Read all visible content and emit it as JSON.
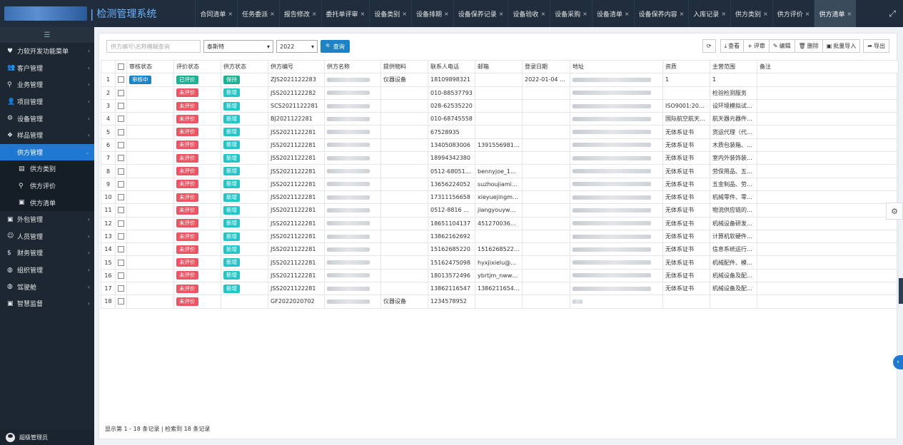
{
  "app": {
    "title": "检测管理系统",
    "separator": "|"
  },
  "tabs": [
    {
      "label": "合同清单"
    },
    {
      "label": "任务委派"
    },
    {
      "label": "报告修改"
    },
    {
      "label": "委托单评审"
    },
    {
      "label": "设备类别"
    },
    {
      "label": "设备排期"
    },
    {
      "label": "设备保养记录"
    },
    {
      "label": "设备验收"
    },
    {
      "label": "设备采购"
    },
    {
      "label": "设备清单"
    },
    {
      "label": "设备保养内容"
    },
    {
      "label": "入库记录"
    },
    {
      "label": "供方类别"
    },
    {
      "label": "供方评价"
    },
    {
      "label": "供方清单",
      "active": true
    }
  ],
  "tab_close": "×",
  "sidebar": {
    "toggle": "☰",
    "items": [
      {
        "label": "力软开发功能菜单",
        "icon": "heart-icon"
      },
      {
        "label": "客户管理",
        "icon": "users-icon"
      },
      {
        "label": "业务管理",
        "icon": "pin-icon"
      },
      {
        "label": "项目管理",
        "icon": "user-icon"
      },
      {
        "label": "设备管理",
        "icon": "cogs-icon"
      },
      {
        "label": "样品管理",
        "icon": "cube-icon"
      },
      {
        "label": "供方管理",
        "icon": "user-icon",
        "active": true
      }
    ],
    "subitems": [
      {
        "label": "供方类别",
        "icon": "id-card-icon"
      },
      {
        "label": "供方评价",
        "icon": "pin-icon"
      },
      {
        "label": "供方清单",
        "icon": "file-icon"
      }
    ],
    "items_after": [
      {
        "label": "外包管理",
        "icon": "file-icon"
      },
      {
        "label": "人员管理",
        "icon": "person-icon"
      },
      {
        "label": "财务管理",
        "icon": "dollar-icon"
      },
      {
        "label": "组织管理",
        "icon": "globe-icon"
      },
      {
        "label": "驾驶舱",
        "icon": "globe-icon"
      },
      {
        "label": "智慧监督",
        "icon": "file-icon"
      }
    ],
    "footer_user": "超级管理员"
  },
  "toolbar": {
    "search_placeholder": "供方编号\\名称模糊查询",
    "supplier_select": "泰斯特",
    "year_select": "2022",
    "query_label": "查询",
    "query_icon": "🔍",
    "refresh_icon": "⟳",
    "view_label": "查看",
    "review_label": "评审",
    "edit_label": "编辑",
    "delete_label": "删除",
    "import_label": "批量导入",
    "export_label": "导出"
  },
  "table": {
    "columns": [
      "审核状态",
      "评价状态",
      "供方状态",
      "供方编号",
      "供方名称",
      "提供物料",
      "联系人电话",
      "邮箱",
      "登录日期",
      "地址",
      "资质",
      "主营范围",
      "备注"
    ],
    "rows": [
      {
        "idx": "1",
        "audit": "审核中",
        "eval": "已评价",
        "status": "保持",
        "code": "ZJS2021122283",
        "material": "仪器设备",
        "phone": "18109898321",
        "email": "",
        "date": "2022-01-04 1...",
        "qual": "1",
        "scope": "1",
        "name_blur": true,
        "addr_blur": true
      },
      {
        "idx": "2",
        "audit": "",
        "eval": "未评价",
        "status": "新增",
        "code": "JSS2021122282",
        "material": "",
        "phone": "010-88537793",
        "email": "",
        "date": "",
        "qual": "",
        "scope": "检验检测服务",
        "name_blur": true,
        "addr_blur": true
      },
      {
        "idx": "3",
        "audit": "",
        "eval": "未评价",
        "status": "新增",
        "code": "SCS2021122281",
        "material": "",
        "phone": "028-62535220",
        "email": "",
        "date": "",
        "qual": "ISO9001:2015...",
        "scope": "设环境模拟试...",
        "name_blur": true,
        "addr_blur": true
      },
      {
        "idx": "4",
        "audit": "",
        "eval": "未评价",
        "status": "新增",
        "code": "BJ2021122281",
        "material": "",
        "phone": "010-68745558",
        "email": "",
        "date": "",
        "qual": "国际航空航天...",
        "scope": "航天器元器件...",
        "name_blur": true,
        "addr_blur": true
      },
      {
        "idx": "5",
        "audit": "",
        "eval": "未评价",
        "status": "新增",
        "code": "JSS2021122281",
        "material": "",
        "phone": "67528935",
        "email": "",
        "date": "",
        "qual": "无体系证书",
        "scope": "货运代理（代...",
        "name_blur": true,
        "addr_blur": true
      },
      {
        "idx": "6",
        "audit": "",
        "eval": "未评价",
        "status": "新增",
        "code": "JSS2021122281",
        "material": "",
        "phone": "13405083006",
        "email": "13915569810...",
        "date": "",
        "qual": "无体系证书",
        "scope": "木质包装箱、...",
        "name_blur": true,
        "addr_blur": true
      },
      {
        "idx": "7",
        "audit": "",
        "eval": "未评价",
        "status": "新增",
        "code": "JSS2021122281",
        "material": "",
        "phone": "18994342380",
        "email": "",
        "date": "",
        "qual": "无体系证书",
        "scope": "室内外装饰装...",
        "name_blur": true,
        "addr_blur": true
      },
      {
        "idx": "8",
        "audit": "",
        "eval": "未评价",
        "status": "新增",
        "code": "JSS2021122281",
        "material": "",
        "phone": "0512-68051636",
        "email": "bennyjoe_123...",
        "date": "",
        "qual": "无体系证书",
        "scope": "劳保用品、五...",
        "name_blur": true,
        "addr_blur": true
      },
      {
        "idx": "9",
        "audit": "",
        "eval": "未评价",
        "status": "新增",
        "code": "JSS2021122281",
        "material": "",
        "phone": "13656224052",
        "email": "suzhoujiami@...",
        "date": "",
        "qual": "无体系证书",
        "scope": "五金制品、劳...",
        "name_blur": true,
        "addr_blur": true
      },
      {
        "idx": "10",
        "audit": "",
        "eval": "未评价",
        "status": "新增",
        "code": "JSS2021122281",
        "material": "",
        "phone": "17311156658",
        "email": "xieyuejingmiz...",
        "date": "",
        "qual": "无体系证书",
        "scope": "机械零件、零...",
        "name_blur": true,
        "addr_blur": true
      },
      {
        "idx": "11",
        "audit": "",
        "eval": "未评价",
        "status": "新增",
        "code": "JSS2021122281",
        "material": "",
        "phone": "0512-8816 02...",
        "email": "jiangyouyw@...",
        "date": "",
        "qual": "无体系证书",
        "scope": "物流供应链的...",
        "name_blur": true,
        "addr_blur": true
      },
      {
        "idx": "12",
        "audit": "",
        "eval": "未评价",
        "status": "新增",
        "code": "JSS2021122281",
        "material": "",
        "phone": "18651104137",
        "email": "451270036@...",
        "date": "",
        "qual": "无体系证书",
        "scope": "机械设备研发...",
        "name_blur": true,
        "addr_blur": true
      },
      {
        "idx": "13",
        "audit": "",
        "eval": "未评价",
        "status": "新增",
        "code": "JSS2021122281",
        "material": "",
        "phone": "13862162692",
        "email": "",
        "date": "",
        "qual": "无体系证书",
        "scope": "计算机软硬件...",
        "name_blur": true,
        "addr_blur": true
      },
      {
        "idx": "14",
        "audit": "",
        "eval": "未评价",
        "status": "新增",
        "code": "JSS2021122281",
        "material": "",
        "phone": "15162685220",
        "email": "15162685220...",
        "date": "",
        "qual": "无体系证书",
        "scope": "信息系统运行...",
        "name_blur": true,
        "addr_blur": true
      },
      {
        "idx": "15",
        "audit": "",
        "eval": "未评价",
        "status": "新增",
        "code": "JSS2021122281",
        "material": "",
        "phone": "15162475098",
        "email": "hyxjixielu@16...",
        "date": "",
        "qual": "无体系证书",
        "scope": "机械配件、模...",
        "name_blur": true,
        "addr_blur": true
      },
      {
        "idx": "16",
        "audit": "",
        "eval": "未评价",
        "status": "新增",
        "code": "JSS2021122281",
        "material": "",
        "phone": "18013572496",
        "email": "ybrtjm_nww@...",
        "date": "",
        "qual": "无体系证书",
        "scope": "机械设备及配...",
        "name_blur": true,
        "addr_blur": true
      },
      {
        "idx": "17",
        "audit": "",
        "eval": "未评价",
        "status": "新增",
        "code": "JSS2021122281",
        "material": "",
        "phone": "13862116547",
        "email": "13862116547...",
        "date": "",
        "qual": "无体系证书",
        "scope": "机械设备及配...",
        "name_blur": true,
        "addr_blur": true
      },
      {
        "idx": "18",
        "audit": "",
        "eval": "未评价",
        "status": "",
        "code": "GF2022020702",
        "material": "仪器设备",
        "phone": "1234578952",
        "email": "",
        "date": "",
        "qual": "",
        "scope": "",
        "name_blur": true,
        "addr_blur": true
      }
    ]
  },
  "footer": {
    "summary": "显示第 1 - 18 条记录 | 检索到 18 条记录"
  },
  "colors": {
    "audit": "#1c84c6",
    "eval_done": "#1ab394",
    "eval_pending": "#ed5565",
    "status_keep": "#1ab394",
    "status_new": "#23c6c8",
    "accent": "#1f78d1"
  },
  "side_controls": {
    "gear": "⚙",
    "collapse": "‹"
  }
}
